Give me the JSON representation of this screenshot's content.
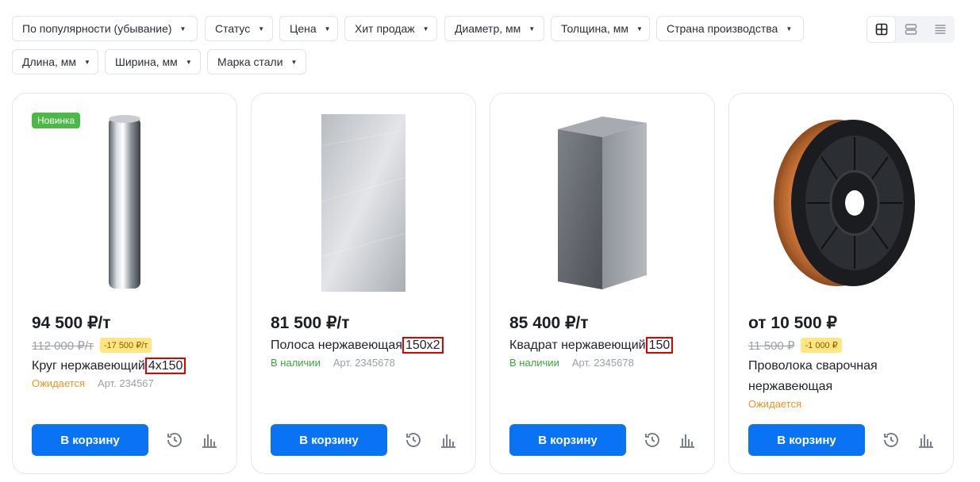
{
  "filters": [
    {
      "label": "По популярности (убывание)"
    },
    {
      "label": "Статус"
    },
    {
      "label": "Цена"
    },
    {
      "label": "Хит продаж"
    },
    {
      "label": "Диаметр, мм"
    },
    {
      "label": "Толщина, мм"
    },
    {
      "label": "Страна производства"
    },
    {
      "label": "Длина, мм"
    },
    {
      "label": "Ширина, мм"
    },
    {
      "label": "Марка стали"
    }
  ],
  "view_modes": [
    "grid-view-icon",
    "list-view-icon",
    "compact-list-icon"
  ],
  "products": [
    {
      "badge": "Новинка",
      "price": "94 500 ₽/т",
      "old_price": "112 000 ₽/т",
      "discount": "-17 500 ₽/т",
      "title": "Круг нержавеющий",
      "title_size": "4x150",
      "status": "Ожидается",
      "article": "Арт. 234567",
      "cart": "В корзину",
      "image": "steel-rod-image"
    },
    {
      "price": "81 500 ₽/т",
      "title": "Полоса нержавеющая",
      "title_size": "150x2",
      "status": "В наличии",
      "article": "Арт. 2345678",
      "cart": "В корзину",
      "image": "steel-strip-image"
    },
    {
      "price": "85 400 ₽/т",
      "title": "Квадрат нержавеющий",
      "title_size": "150",
      "status": "В наличии",
      "article": "Арт. 2345678",
      "cart": "В корзину",
      "image": "steel-square-bar-image"
    },
    {
      "price": "от 10 500 ₽",
      "old_price": "11 500 ₽",
      "discount": "-1 000 ₽",
      "title": "Проволока сварочная нержавеющая",
      "status": "Ожидается",
      "cart": "В корзину",
      "image": "welding-wire-spool-image"
    }
  ],
  "colors": {
    "accent": "#0a73f4",
    "new_badge": "#4cb847",
    "in_stock": "#37a83a",
    "waiting": "#f0921f",
    "discount_bg": "#ffe680",
    "highlight": "#e00000"
  }
}
